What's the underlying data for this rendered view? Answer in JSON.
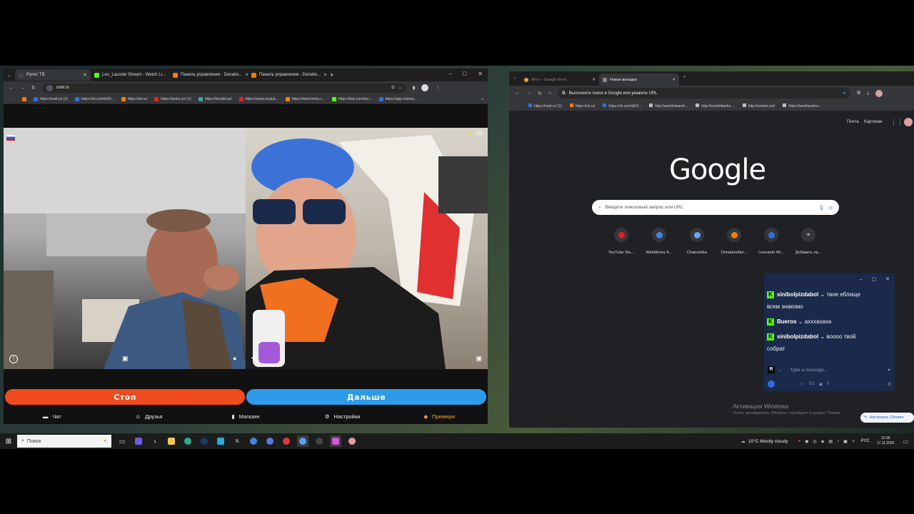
{
  "left_browser": {
    "tabs": [
      {
        "label": "Рулет ТВ",
        "color": "#222"
      },
      {
        "label": "Leo_Lacoste Stream - Watch Li...",
        "color": "#53fc18"
      },
      {
        "label": "Панель управления - Donatio...",
        "color": "#f57d07"
      },
      {
        "label": "Панель управления - Donatio...",
        "color": "#f57d07"
      }
    ],
    "new_tab": "+",
    "url": "rulet.tv",
    "bookmarks": [
      {
        "label": "https://mail.ru/ (3)",
        "color": "#2f6fe0"
      },
      {
        "label": "https://vk.com/id19...",
        "color": "#2f6fe0"
      },
      {
        "label": "https://ok.ru/",
        "color": "#f57d07"
      },
      {
        "label": "https://tanks.su/ (1)",
        "color": "#e02020"
      },
      {
        "label": "https://korabli.su/",
        "color": "#3aa3a3"
      },
      {
        "label": "https://www.youtub...",
        "color": "#e02020"
      },
      {
        "label": "https://www.temu.c...",
        "color": "#f57d07"
      },
      {
        "label": "https://kick.com/leo...",
        "color": "#53fc18"
      },
      {
        "label": "https://app.restrea...",
        "color": "#2f6fe0"
      }
    ]
  },
  "roulette": {
    "star_count": "25",
    "stop_label": "Стоп",
    "next_label": "Дальше",
    "nav": [
      {
        "icon": "chat-icon",
        "label": "Чат"
      },
      {
        "icon": "friends-icon",
        "label": "Друзья"
      },
      {
        "icon": "shop-icon",
        "label": "Магазин"
      },
      {
        "icon": "gear-icon",
        "label": "Настройки"
      },
      {
        "icon": "premium-icon",
        "label": "Премиум"
      }
    ],
    "premium_color": "#f5a524"
  },
  "right_browser": {
    "tabs": [
      {
        "label": "Фото - Google Фото"
      },
      {
        "label": "Новая вкладка"
      }
    ],
    "omnibox": "Выполните поиск в Google или укажите URL",
    "bookmarks": [
      "https://mail.ru/ (1)",
      "https://ok.ru/",
      "https://vk.com/id19...",
      "http://worldofwarsh...",
      "http://worldoftanks....",
      "http://wotsite.net/",
      "https://warthunder.r..."
    ],
    "top_links": [
      "Почта",
      "Картинки"
    ],
    "google_logo": "Google",
    "search_placeholder": "Введите поисковый запрос или URL",
    "shortcuts": [
      {
        "label": "YouTube Stu...",
        "color": "#e02020"
      },
      {
        "label": "WebMoney K...",
        "color": "#3a86e0"
      },
      {
        "label": "Chatruletka",
        "color": "#6aa5f0"
      },
      {
        "label": "DonationAler...",
        "color": "#f57d07"
      },
      {
        "label": "Leonardo Wi...",
        "color": "#2f6fe0"
      },
      {
        "label": "Добавить яр...",
        "color": "#35363a"
      }
    ],
    "activation_title": "Активация Windows",
    "activation_text": "Чтобы активировать Windows, перейдите в раздел \"Парам",
    "customize_chrome": "Настроить Chrome"
  },
  "chat_overlay": {
    "messages": [
      {
        "user": "sinibolpizdabol",
        "text": "твое еблище",
        "cont": "всем знакомо"
      },
      {
        "user": "Bueros",
        "text": "ахххахаха",
        "cont": ""
      },
      {
        "user": "sinibolpizdabol",
        "text": "вoooo твой",
        "cont": "собрат"
      }
    ],
    "input_placeholder": "Type a message...",
    "viewers": "1/1",
    "views": "0"
  },
  "taskbar": {
    "search_placeholder": "Поиск",
    "weather": "10°C  Mostly cloudy",
    "lang": "РУС",
    "time": "12:36",
    "date": "17.11.2025"
  }
}
